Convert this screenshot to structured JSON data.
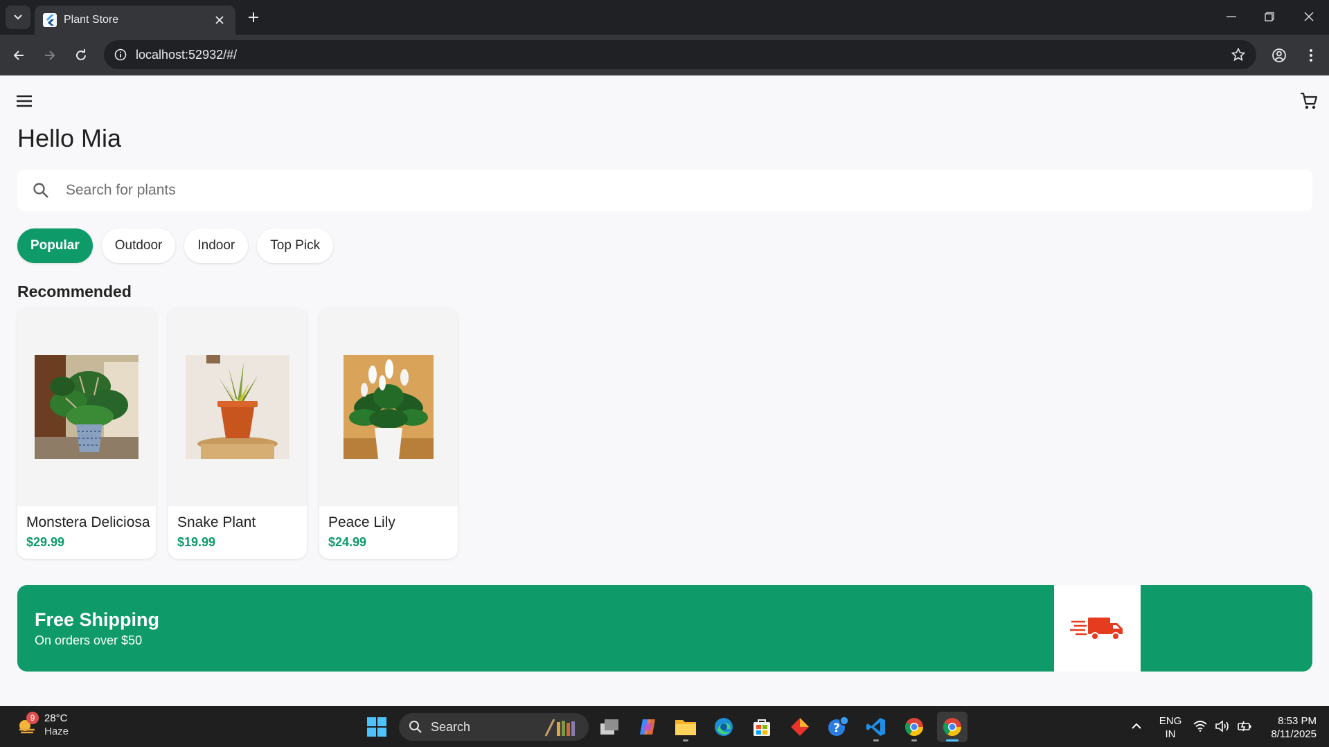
{
  "browser": {
    "tab_title": "Plant Store",
    "url": "localhost:52932/#/"
  },
  "app": {
    "greeting": "Hello Mia",
    "search_placeholder": "Search for plants",
    "categories": [
      {
        "label": "Popular",
        "active": true
      },
      {
        "label": "Outdoor",
        "active": false
      },
      {
        "label": "Indoor",
        "active": false
      },
      {
        "label": "Top Pick",
        "active": false
      }
    ],
    "section_title": "Recommended",
    "products": [
      {
        "name": "Monstera Deliciosa",
        "price": "$29.99"
      },
      {
        "name": "Snake Plant",
        "price": "$19.99"
      },
      {
        "name": "Peace Lily",
        "price": "$24.99"
      }
    ],
    "banner": {
      "title": "Free Shipping",
      "subtitle": "On orders over $50"
    },
    "accent_color": "#0f9a6a"
  },
  "taskbar": {
    "weather_badge": "9",
    "temperature": "28°C",
    "condition": "Haze",
    "search_label": "Search",
    "lang_line1": "ENG",
    "lang_line2": "IN",
    "time": "8:53 PM",
    "date": "8/11/2025"
  }
}
